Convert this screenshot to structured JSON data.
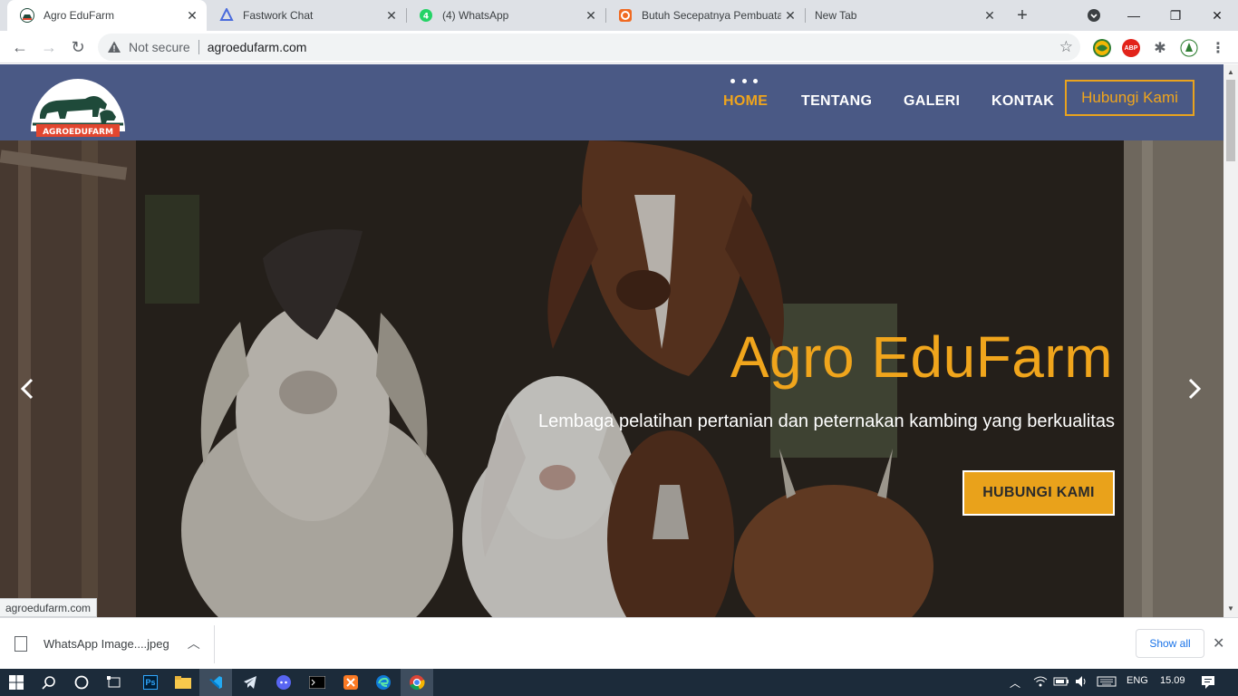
{
  "browser": {
    "tabs": [
      {
        "title": "Agro EduFarm",
        "active": true
      },
      {
        "title": "Fastwork Chat",
        "active": false
      },
      {
        "title": "(4) WhatsApp",
        "active": false
      },
      {
        "title": "Butuh Secepatnya Pembuatan",
        "active": false
      },
      {
        "title": "New Tab",
        "active": false
      }
    ],
    "security_label": "Not secure",
    "url": "agroedufarm.com",
    "extensions": [
      "globe-extension-icon",
      "adblock-plus-icon",
      "puzzle-icon",
      "profile-avatar"
    ],
    "abp_text": "ABP"
  },
  "site": {
    "logo_text": "AGROEDUFARM",
    "nav": [
      {
        "label": "HOME",
        "active": true
      },
      {
        "label": "TENTANG",
        "active": false
      },
      {
        "label": "GALERI",
        "active": false
      },
      {
        "label": "KONTAK",
        "active": false
      }
    ],
    "cta_top": "Hubungi Kami",
    "hero": {
      "title": "Agro EduFarm",
      "subtitle": "Lembaga pelatihan pertanian dan peternakan kambing yang berkualitas",
      "button": "HUBUNGI KAMI",
      "prev_icon": "chevron-left-icon",
      "next_icon": "chevron-right-icon"
    },
    "colors": {
      "nav_bg": "#4a5985",
      "accent": "#f0a51c"
    }
  },
  "status_bar_url": "agroedufarm.com",
  "downloads": {
    "items": [
      {
        "name": "WhatsApp Image....jpeg"
      }
    ],
    "show_all": "Show all"
  },
  "taskbar": {
    "apps": [
      "windows-start-icon",
      "search-icon",
      "cortana-icon",
      "task-view-icon",
      "photoshop-icon",
      "file-explorer-icon",
      "vscode-icon",
      "telegram-icon",
      "discord-icon",
      "terminal-icon",
      "xampp-icon",
      "edge-icon",
      "chrome-icon"
    ],
    "photoshop_label": "Ps",
    "language": "ENG",
    "time": "15.09"
  }
}
